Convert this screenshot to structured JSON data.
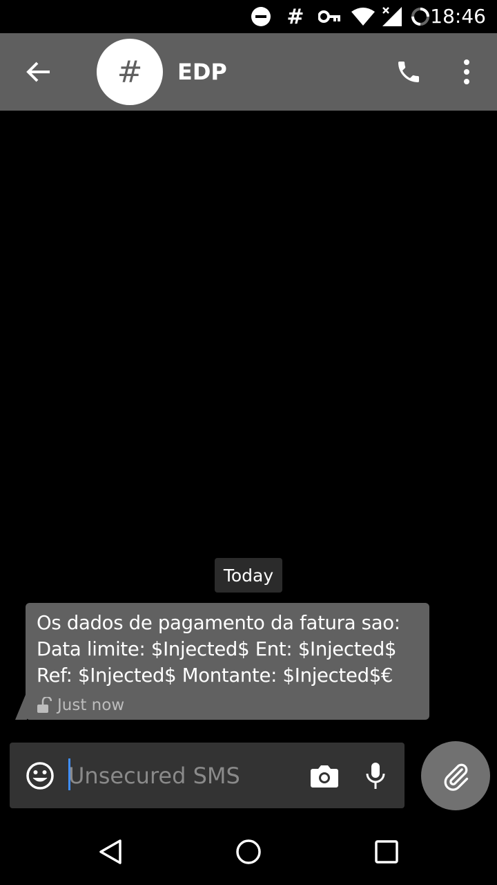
{
  "status_bar": {
    "time": "18:46",
    "icons": [
      "do-not-disturb-icon",
      "hashtag-icon",
      "vpn-key-icon",
      "wifi-icon",
      "signal-icon",
      "battery-icon"
    ]
  },
  "app_bar": {
    "avatar_symbol": "#",
    "contact_name": "EDP",
    "background_color": "#5f5f5f"
  },
  "conversation": {
    "date_label": "Today",
    "messages": [
      {
        "text": "Os dados de pagamento da fatura sao:\nData limite: $Injected$ Ent: $Injected$\nRef: $Injected$ Montante: $Injected$€",
        "timestamp": "Just now",
        "secure": false,
        "bubble_color": "#616161"
      }
    ]
  },
  "compose": {
    "placeholder": "Unsecured SMS",
    "value": ""
  },
  "nav_bar": {
    "buttons": [
      "back-triangle-icon",
      "home-circle-icon",
      "recents-square-icon"
    ]
  }
}
